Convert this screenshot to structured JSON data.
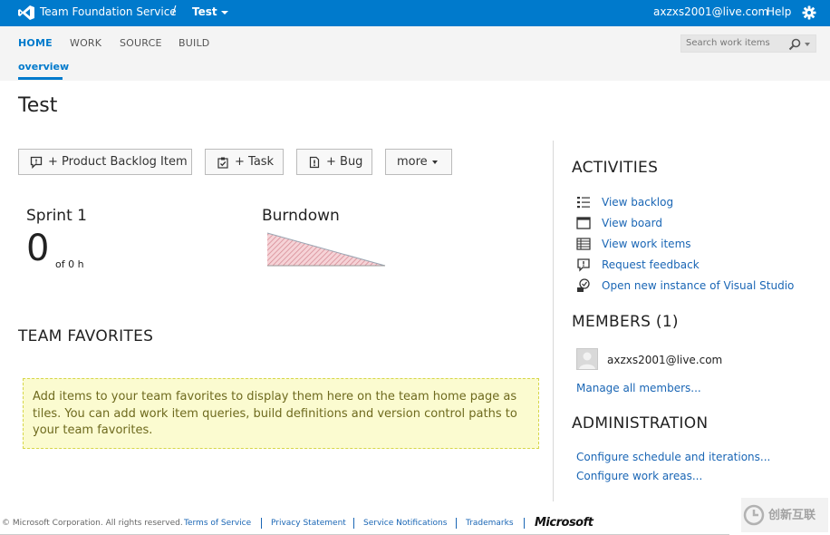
{
  "topbar": {
    "brand": "Team Foundation Service",
    "separator": "/",
    "project": "Test",
    "user": "axzxs2001@live.com",
    "help": "Help"
  },
  "nav": {
    "tabs": [
      "HOME",
      "WORK",
      "SOURCE",
      "BUILD"
    ],
    "active_tab": "HOME",
    "subtab": "overview",
    "search_placeholder": "Search work items"
  },
  "page": {
    "title": "Test"
  },
  "new_buttons": {
    "product_backlog_item": "+ Product Backlog Item",
    "task": "+ Task",
    "bug": "+ Bug",
    "more": "more"
  },
  "sprint": {
    "title": "Sprint 1",
    "remaining": "0",
    "of_total": "of 0 h"
  },
  "burndown": {
    "title": "Burndown"
  },
  "team_favorites": {
    "title": "TEAM FAVORITES",
    "message": "Add items to your team favorites to display them here on the team home page as tiles. You can add work item queries, build definitions and version control paths to your team favorites."
  },
  "activities": {
    "title": "ACTIVITIES",
    "items": [
      {
        "label": "View backlog",
        "icon": "backlog-list-icon"
      },
      {
        "label": "View board",
        "icon": "board-icon"
      },
      {
        "label": "View work items",
        "icon": "work-items-grid-icon"
      },
      {
        "label": "Request feedback",
        "icon": "feedback-bubble-icon"
      },
      {
        "label": "Open new instance of Visual Studio",
        "icon": "visual-studio-icon"
      }
    ]
  },
  "members": {
    "title": "MEMBERS (1)",
    "list": [
      {
        "name": "axzxs2001@live.com"
      }
    ],
    "manage_link": "Manage all members..."
  },
  "administration": {
    "title": "ADMINISTRATION",
    "links": [
      "Configure schedule and iterations...",
      "Configure work areas..."
    ]
  },
  "footer": {
    "copyright": "© Microsoft Corporation. All rights reserved.",
    "links": [
      "Terms of Service",
      "Privacy Statement",
      "Service Notifications",
      "Trademarks"
    ],
    "logo_text": "Microsoft"
  },
  "watermark": {
    "text": "创新互联"
  },
  "colors": {
    "accent": "#007acc",
    "link": "#1a66b5",
    "favorites_bg": "#fbfbd0",
    "burndown_fill": "#e8a0a8"
  }
}
